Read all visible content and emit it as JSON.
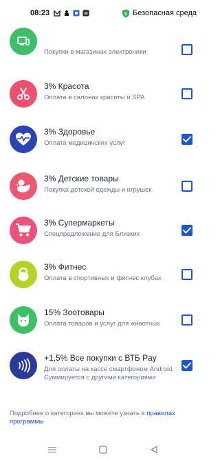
{
  "status_bar": {
    "time": "08:23",
    "icons": [
      "gmail-icon",
      "notification-icon",
      "app-icon",
      "app-icon"
    ],
    "secure_label": "Безопасная среда",
    "secure_color": "#2db34a"
  },
  "header": {
    "back_icon": "chevron-left-icon"
  },
  "categories": [
    {
      "title": "",
      "desc": "Покупки в магазинах электроники",
      "icon": "electronics-icon",
      "color": "#3dbf67",
      "checked": false
    },
    {
      "title": "3% Красота",
      "desc": "Оплата в салонах красоты и SPA",
      "icon": "scissors-icon",
      "color": "#f04e6e",
      "checked": false
    },
    {
      "title": "3% Здоровье",
      "desc": "Оплата медицинских услуг",
      "icon": "heart-pulse-icon",
      "color": "#2a44b8",
      "checked": true
    },
    {
      "title": "3% Детские товары",
      "desc": "Покупка детской одежды и игрушек",
      "icon": "duck-icon",
      "color": "#f0566f",
      "checked": false
    },
    {
      "title": "3% Супермаркеты",
      "desc": "Спецпредложение для Близких",
      "icon": "cart-icon",
      "color": "#f0507a",
      "checked": true
    },
    {
      "title": "3% Фитнес",
      "desc": "Оплата в спортивных и фитнес клубах",
      "icon": "kettlebell-icon",
      "color": "#b5d324",
      "checked": false
    },
    {
      "title": "15% Зоотовары",
      "desc": "Оплата товаров и услуг для животных",
      "icon": "cat-icon",
      "color": "#3dbf67",
      "checked": false
    },
    {
      "title": "+1,5% Все покупки с ВТБ Pay",
      "desc": "Для оплаты на кассе смартфоном Android. Суммируется с другими категориями",
      "icon": "contactless-icon",
      "color": "#2a3a9a",
      "checked": true
    }
  ],
  "footer": {
    "text": "Подробнее о категориях вы можете узнать в ",
    "link": "правилах программы"
  },
  "nav": [
    "menu-icon",
    "home-icon",
    "back-icon"
  ]
}
